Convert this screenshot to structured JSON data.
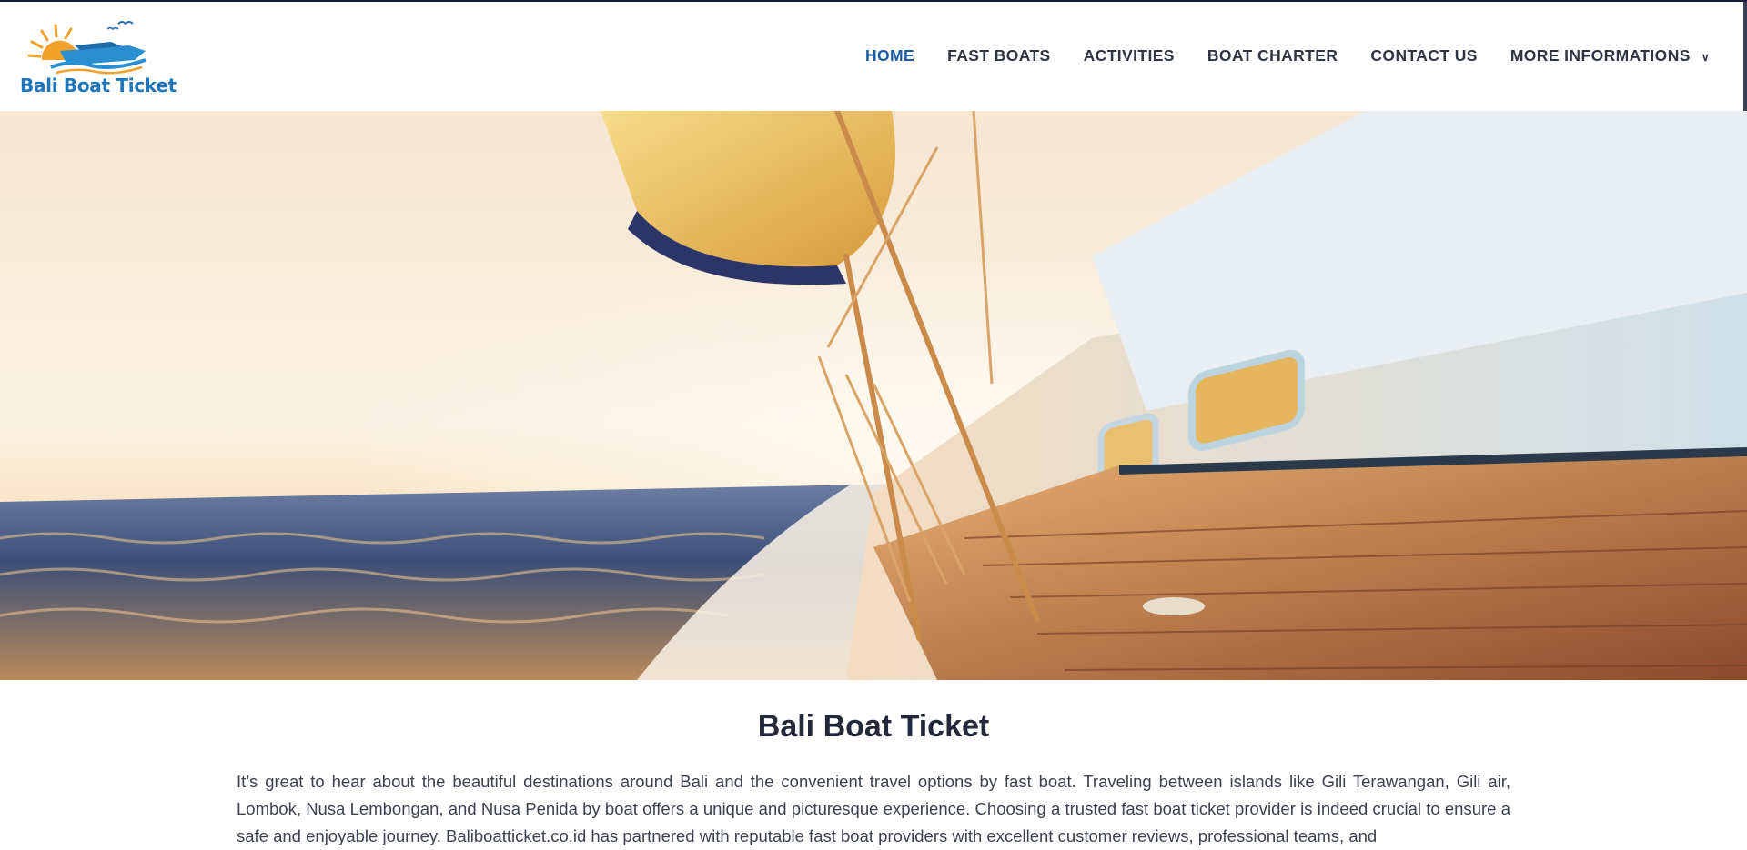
{
  "brand": {
    "name": "Bali Boat Ticket",
    "colors": {
      "logo_text": "#1f76b8",
      "sun": "#f2a12a",
      "wave": "#2a8fd0"
    }
  },
  "nav": {
    "items": [
      {
        "label": "HOME",
        "active": true
      },
      {
        "label": "FAST BOATS",
        "active": false
      },
      {
        "label": "ACTIVITIES",
        "active": false
      },
      {
        "label": "BOAT CHARTER",
        "active": false
      },
      {
        "label": "CONTACT US",
        "active": false
      },
      {
        "label": "MORE INFORMATIONS",
        "active": false,
        "has_dropdown": true
      }
    ],
    "dropdown_icon": "chevron-down-icon",
    "colors": {
      "active": "#1a5aa8",
      "default": "#2e3442"
    }
  },
  "hero": {
    "image": "sailboat-deck-at-sunset-over-sea"
  },
  "content": {
    "title": "Bali Boat Ticket",
    "intro": "It’s great to hear about the beautiful destinations around Bali and the convenient travel options by fast boat. Traveling between islands like Gili Terawangan, Gili air, Lombok, Nusa Lembongan, and Nusa Penida by boat offers a unique and picturesque experience. Choosing a trusted fast boat ticket provider is indeed crucial to ensure a safe and enjoyable journey. Baliboatticket.co.id has partnered with reputable fast boat providers with excellent customer reviews, professional teams, and"
  }
}
